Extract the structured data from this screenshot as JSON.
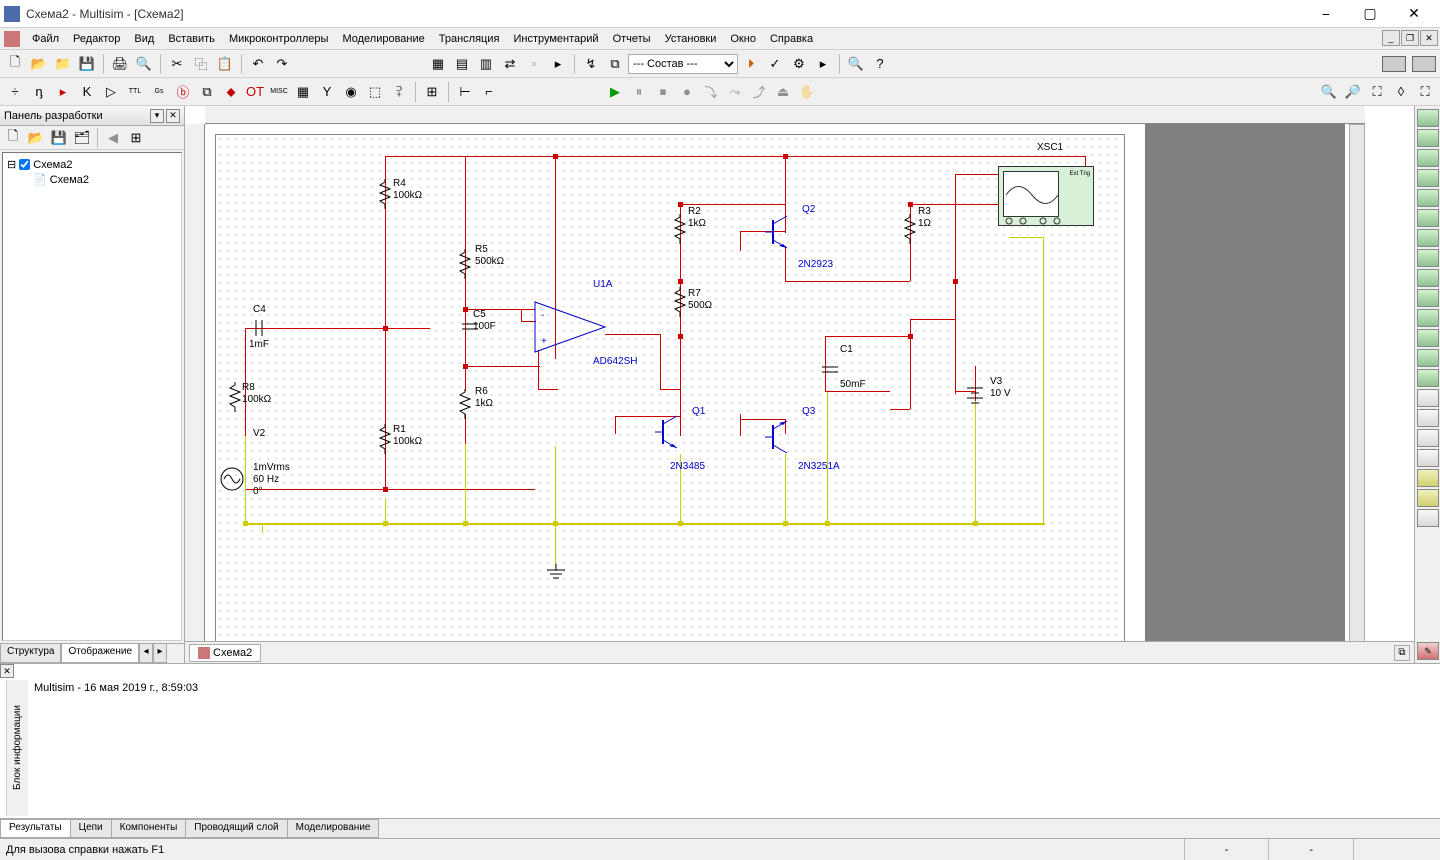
{
  "window": {
    "title": "Схема2 - Multisim - [Схема2]"
  },
  "menu": {
    "file": "Файл",
    "edit": "Редактор",
    "view": "Вид",
    "insert": "Вставить",
    "mcu": "Микроконтроллеры",
    "sim": "Моделирование",
    "trans": "Трансляция",
    "instr": "Инструментарий",
    "reports": "Отчеты",
    "options": "Установки",
    "window": "Окно",
    "help": "Справка"
  },
  "toolbar": {
    "compose_label": "--- Состав ---"
  },
  "left_panel": {
    "title": "Панель разработки",
    "tree": {
      "root": "Схема2",
      "child": "Схема2"
    },
    "tabs": {
      "structure": "Структура",
      "display": "Отображение"
    }
  },
  "bottom_tab": "Схема2",
  "results": {
    "side_label": "Блок информации",
    "log": "Multisim  -  16 мая 2019 г., 8:59:03",
    "tabs": {
      "results": "Результаты",
      "nets": "Цепи",
      "components": "Компоненты",
      "layer": "Проводящий слой",
      "modeling": "Моделирование"
    }
  },
  "status": {
    "help": "Для вызова справки нажать F1"
  },
  "circuit": {
    "XSC1": "XSC1",
    "R4": {
      "ref": "R4",
      "val": "100kΩ"
    },
    "R8": {
      "ref": "R8",
      "val": "100kΩ"
    },
    "C4": {
      "ref": "C4",
      "val": "1mF"
    },
    "V2": {
      "ref": "V2",
      "l1": "1mVrms",
      "l2": "60 Hz",
      "l3": "0°"
    },
    "R1": {
      "ref": "R1",
      "val": "100kΩ"
    },
    "R5": {
      "ref": "R5",
      "val": "500kΩ"
    },
    "R6": {
      "ref": "R6",
      "val": "1kΩ"
    },
    "C5": {
      "ref": "C5",
      "val": "100F"
    },
    "U1A": {
      "ref": "U1A",
      "val": "AD642SH"
    },
    "R2": {
      "ref": "R2",
      "val": "1kΩ"
    },
    "R7": {
      "ref": "R7",
      "val": "500Ω"
    },
    "Q1": {
      "ref": "Q1",
      "val": "2N3485"
    },
    "Q2": {
      "ref": "Q2",
      "val": "2N2923"
    },
    "Q3": {
      "ref": "Q3",
      "val": "2N3251A"
    },
    "C1": {
      "ref": "C1",
      "val": "50mF"
    },
    "R3": {
      "ref": "R3",
      "val": "1Ω"
    },
    "V3": {
      "ref": "V3",
      "val": "10 V"
    },
    "scope_ext": "Ext Trig"
  }
}
